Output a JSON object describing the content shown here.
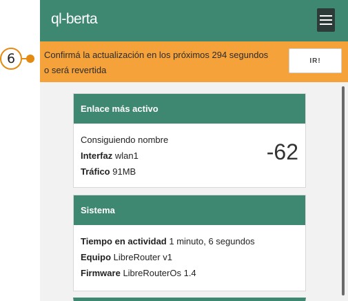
{
  "header": {
    "title": "ql-berta",
    "menu_icon": "hamburger-menu-icon"
  },
  "banner": {
    "text": "Confirmá la actualización en los próximos 294 segundos o será revertida",
    "button_label": "IR!"
  },
  "cards": {
    "link": {
      "title": "Enlace más activo",
      "name": "Consiguiendo nombre",
      "interface_label": "Interfaz",
      "interface_value": "wlan1",
      "traffic_label": "Tráfico",
      "traffic_value": "91MB",
      "signal": "-62"
    },
    "system": {
      "title": "Sistema",
      "uptime_label": "Tiempo en actividad",
      "uptime_value": "1 minuto, 6 segundos",
      "device_label": "Equipo",
      "device_value": "LibreRouter v1",
      "firmware_label": "Firmware",
      "firmware_value": "LibreRouterOs 1.4"
    }
  },
  "annotation": {
    "marker": "6",
    "color": "#e58a10"
  },
  "colors": {
    "primary": "#3e8770",
    "banner": "#f5a23b",
    "menu_button": "#2c3b37"
  }
}
